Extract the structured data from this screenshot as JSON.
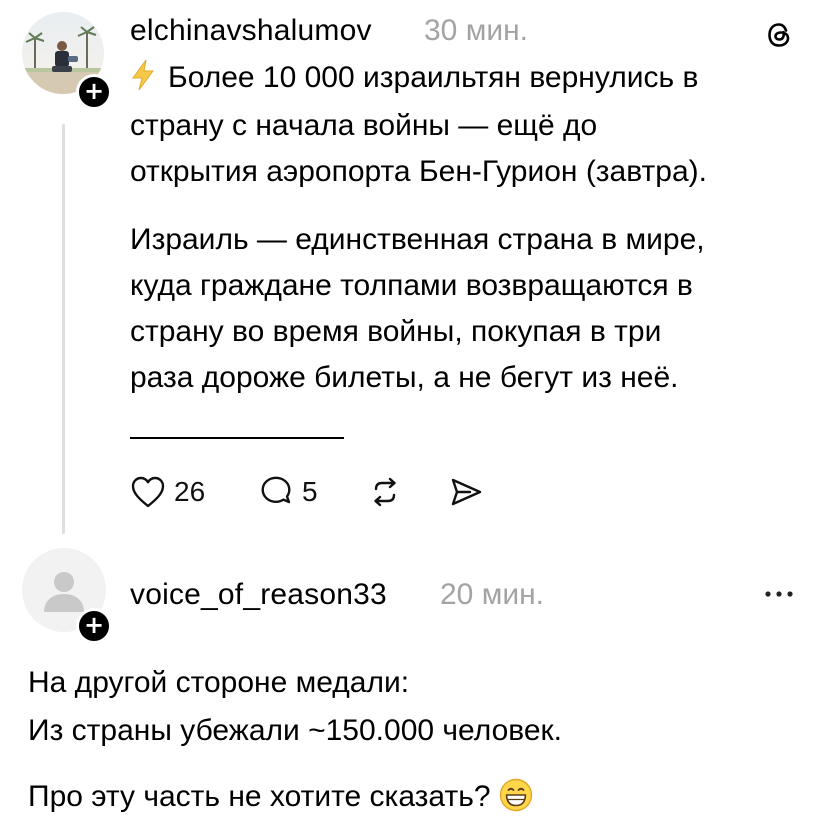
{
  "post": {
    "username": "elchinavshalumov",
    "time": "30 мин.",
    "line1": "Более 10 000 израильтян вернулись в",
    "line2": "страну с начала войны — ещё до",
    "line3": "открытия аэропорта Бен-Гурион (завтра).",
    "line4": "Израиль — единственная страна в мире,",
    "line5": "куда граждане толпами возвращаются в",
    "line6": "страну во время войны, покупая в три",
    "line7": "раза дороже билеты, а не бегут из неё.",
    "likes": "26",
    "replies": "5",
    "icons": {
      "bolt": "lightning-emoji",
      "threads": "threads-logo",
      "like": "heart-icon",
      "reply": "comment-icon",
      "repost": "repost-icon",
      "share": "send-icon",
      "follow": "plus-icon"
    }
  },
  "reply": {
    "username": "voice_of_reason33",
    "time": "20 мин.",
    "line1": "На другой стороне медали:",
    "line2": "Из страны убежали ~150.000 человек.",
    "line3": "Про эту часть не хотите сказать?",
    "icons": {
      "more": "more-dots-icon",
      "emoji": "grinning-face-emoji",
      "follow": "plus-icon"
    }
  },
  "colors": {
    "text": "#000000",
    "muted": "#a3a3a3",
    "thread_line": "#dedede",
    "bolt": "#f7c948"
  }
}
